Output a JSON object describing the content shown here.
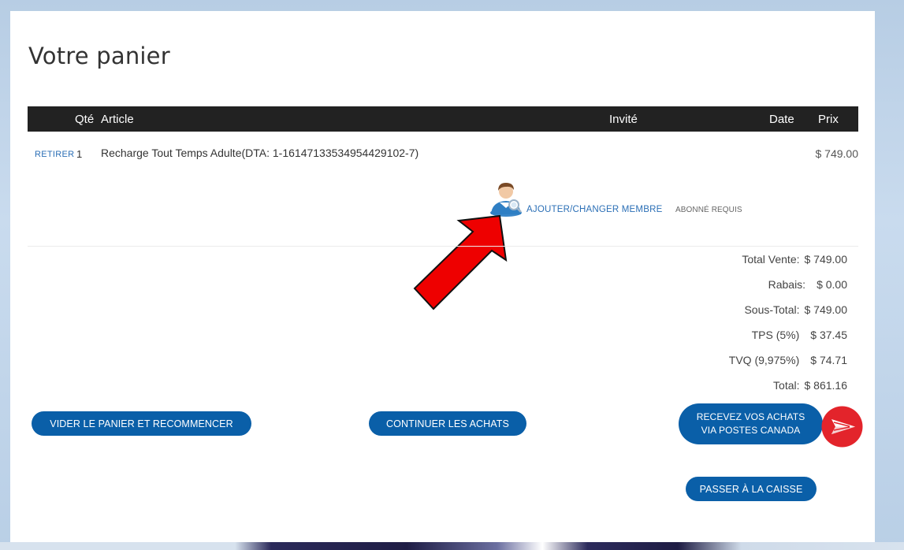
{
  "page": {
    "title": "Votre panier"
  },
  "cart": {
    "columns": {
      "qty": "Qté",
      "article": "Article",
      "guest": "Invité",
      "date": "Date",
      "price": "Prix"
    },
    "items": [
      {
        "remove_label": "RETIRER",
        "qty": "1",
        "name": "Recharge Tout Temps Adulte(DTA: 1-16147133534954429102-7)",
        "price": "$ 749.00",
        "member_link": "AJOUTER/CHANGER MEMBRE",
        "member_required": "ABONNÉ REQUIS",
        "member_icon": "user-search-icon"
      }
    ]
  },
  "totals": [
    {
      "label": "Total Vente:",
      "value": "$ 749.00"
    },
    {
      "label": "Rabais:",
      "value": "$ 0.00"
    },
    {
      "label": "Sous-Total:",
      "value": "$ 749.00"
    },
    {
      "label": "TPS (5%)",
      "value": "$ 37.45"
    },
    {
      "label": "TVQ (9,975%)",
      "value": "$ 74.71"
    },
    {
      "label": "Total:",
      "value": "$ 861.16"
    }
  ],
  "actions": {
    "empty_cart": "VIDER LE PANIER ET RECOMMENCER",
    "continue_shopping": "CONTINUER LES ACHATS",
    "ship_line1": "RECEVEZ VOS ACHATS",
    "ship_line2": "VIA POSTES CANADA",
    "checkout": "PASSER À LA CAISSE"
  },
  "colors": {
    "accent": "#0a5fa8",
    "header_bg": "#222222",
    "annotation_arrow": "#ee0000",
    "postes_logo": "#e3242b"
  },
  "icons": {
    "annotation": "red-arrow-icon",
    "shipping_logo": "canada-post-logo-icon"
  }
}
